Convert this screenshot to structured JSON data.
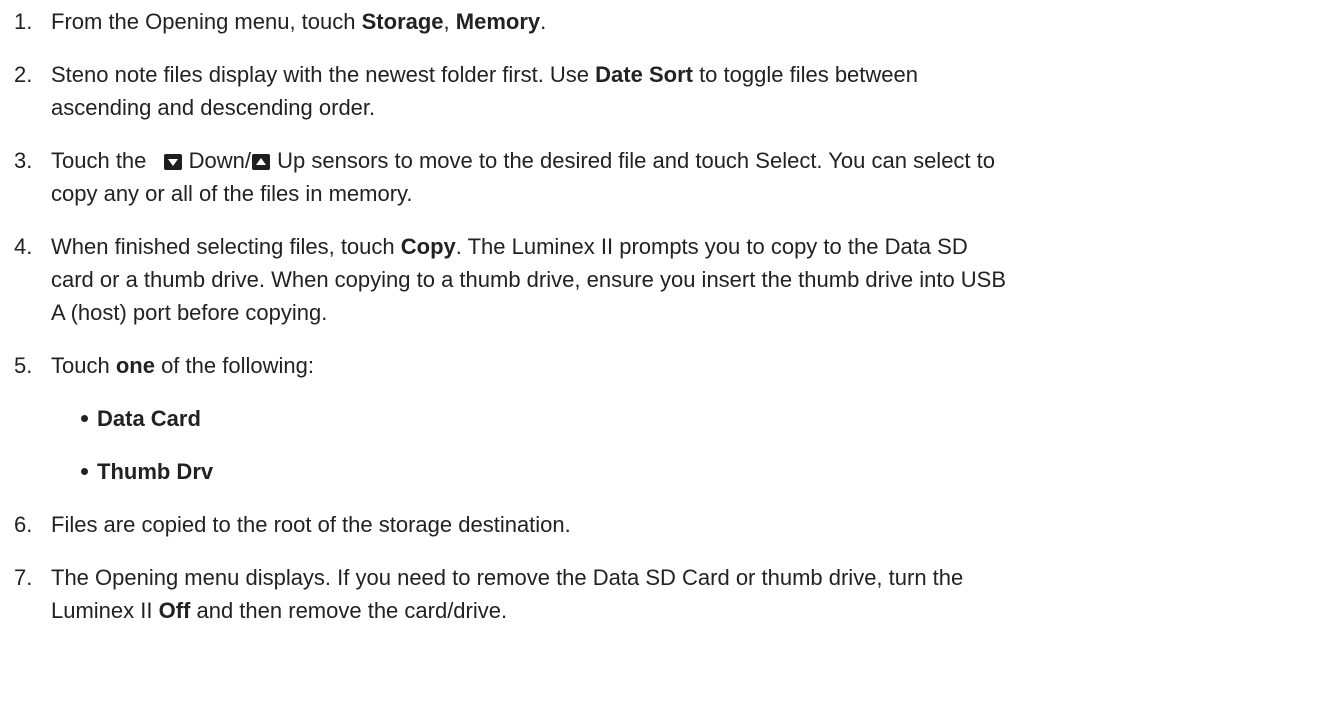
{
  "steps": [
    {
      "number": "1.",
      "t1": "From the Opening menu, touch ",
      "b1": "Storage",
      "t2": ", ",
      "b2": "Memory",
      "t3": "."
    },
    {
      "number": "2.",
      "t1": "Steno note files display with the newest folder first. Use ",
      "b1": "Date Sort",
      "t2": " to toggle files between",
      "t3": "ascending and descending order."
    },
    {
      "number": "3.",
      "t1": "Touch the ",
      "down_label": "Down/",
      "up_label": "Up sensors to move to the desired file and touch Select. You can select to",
      "t2": "copy any or all of the files in memory.",
      "icons": [
        "down-arrow-icon",
        "up-arrow-icon"
      ]
    },
    {
      "number": "4.",
      "t1": "When finished selecting files, touch ",
      "b1": "Copy",
      "t2": ". The Luminex II prompts you to copy to the Data SD",
      "t3": "card or a thumb drive. When copying to a thumb drive, ensure you insert the thumb drive into USB",
      "t4": "A (host) port before copying."
    },
    {
      "number": "5.",
      "t1": "Touch ",
      "b1": "one",
      "t2": " of the following:",
      "options": [
        "Data Card",
        "Thumb Drv"
      ]
    },
    {
      "number": "6.",
      "t1": "Files are copied to the root of the storage destination."
    },
    {
      "number": "7.",
      "t1": "The Opening menu displays. If you need to remove the Data SD Card or thumb drive, turn the",
      "t2": "Luminex II ",
      "b1": "Off",
      "t3": " and then remove the card/drive."
    }
  ]
}
